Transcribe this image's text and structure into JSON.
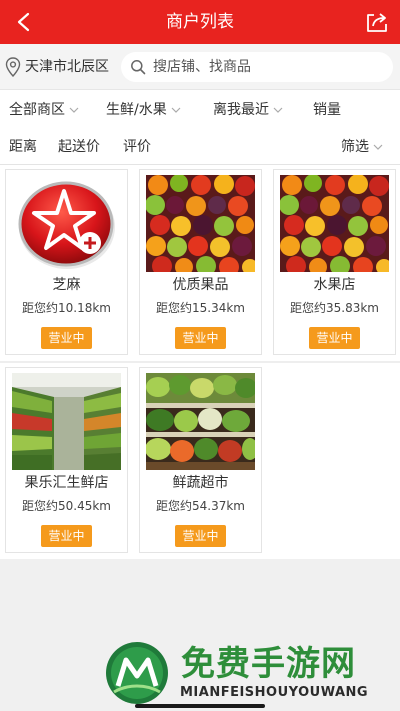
{
  "header": {
    "title": "商户列表",
    "back_icon": "chevron-left-icon",
    "share_icon": "share-icon"
  },
  "location": {
    "city": "天津市北辰区",
    "icon": "location-pin-icon"
  },
  "search": {
    "placeholder": "搜店铺、找商品",
    "value": ""
  },
  "filters": {
    "row1": [
      {
        "label": "全部商区",
        "has_dropdown": true
      },
      {
        "label": "生鲜/水果",
        "has_dropdown": true
      },
      {
        "label": "离我最近",
        "has_dropdown": true
      },
      {
        "label": "销量",
        "has_dropdown": false
      }
    ],
    "row2": [
      {
        "label": "距离"
      },
      {
        "label": "起送价"
      },
      {
        "label": "评价"
      }
    ],
    "filter_label": "筛选"
  },
  "shops": [
    {
      "name": "芝麻",
      "distance": "距您约10.18km",
      "status": "营业中",
      "image": "red-star-logo"
    },
    {
      "name": "优质果品",
      "distance": "距您约15.34km",
      "status": "营业中",
      "image": "fruit-assortment"
    },
    {
      "name": "水果店",
      "distance": "距您约35.83km",
      "status": "营业中",
      "image": "fruit-assortment"
    },
    {
      "name": "果乐汇生鲜店",
      "distance": "距您约50.45km",
      "status": "营业中",
      "image": "produce-shelves"
    },
    {
      "name": "鲜蔬超市",
      "distance": "距您约54.37km",
      "status": "营业中",
      "image": "vegetable-display"
    }
  ],
  "watermark": {
    "cn": "免费手游网",
    "en": "MIANFEISHOUYOUWANG"
  },
  "colors": {
    "header_red": "#e8231f",
    "status_orange": "#f59a1c",
    "watermark_green": "#2e8e3a"
  }
}
